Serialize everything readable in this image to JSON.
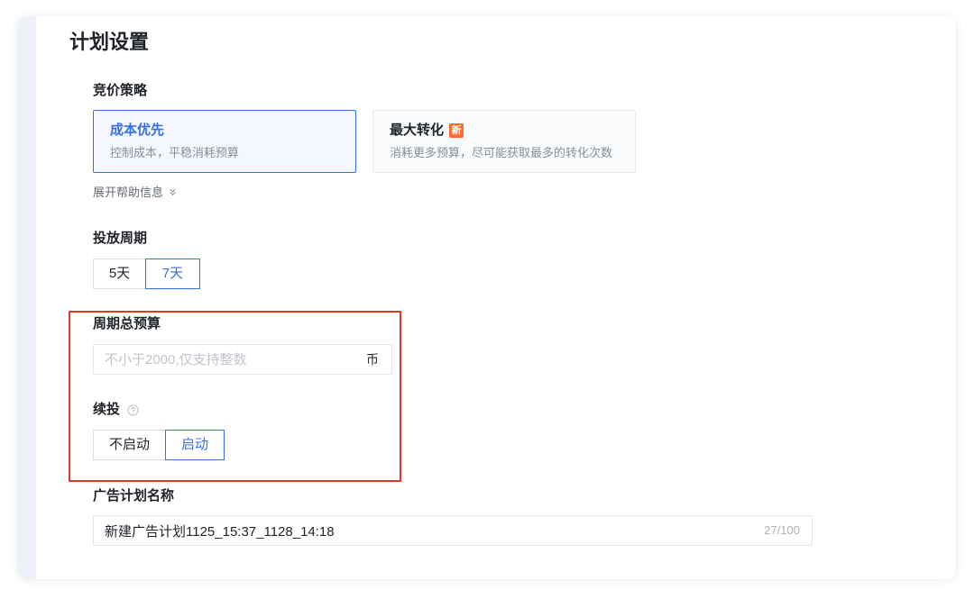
{
  "section_title": "计划设置",
  "bid_strategy": {
    "label": "竞价策略",
    "options": [
      {
        "title": "成本优先",
        "desc": "控制成本，平稳消耗预算",
        "selected": true
      },
      {
        "title": "最大转化",
        "badge": "新",
        "desc": "消耗更多预算，尽可能获取最多的转化次数",
        "selected": false
      }
    ],
    "help_toggle": "展开帮助信息"
  },
  "period": {
    "label": "投放周期",
    "options": [
      {
        "label": "5天",
        "selected": false
      },
      {
        "label": "7天",
        "selected": true
      }
    ]
  },
  "budget": {
    "label": "周期总预算",
    "placeholder": "不小于2000,仅支持整数",
    "suffix": "币"
  },
  "renewal": {
    "label": "续投",
    "options": [
      {
        "label": "不启动",
        "selected": false
      },
      {
        "label": "启动",
        "selected": true
      }
    ]
  },
  "plan_name": {
    "label": "广告计划名称",
    "value": "新建广告计划1125_15:37_1128_14:18",
    "counter": "27/100"
  },
  "colors": {
    "primary": "#3a6fe3",
    "highlight": "#e03a22",
    "badge": "#ff6b2c"
  }
}
